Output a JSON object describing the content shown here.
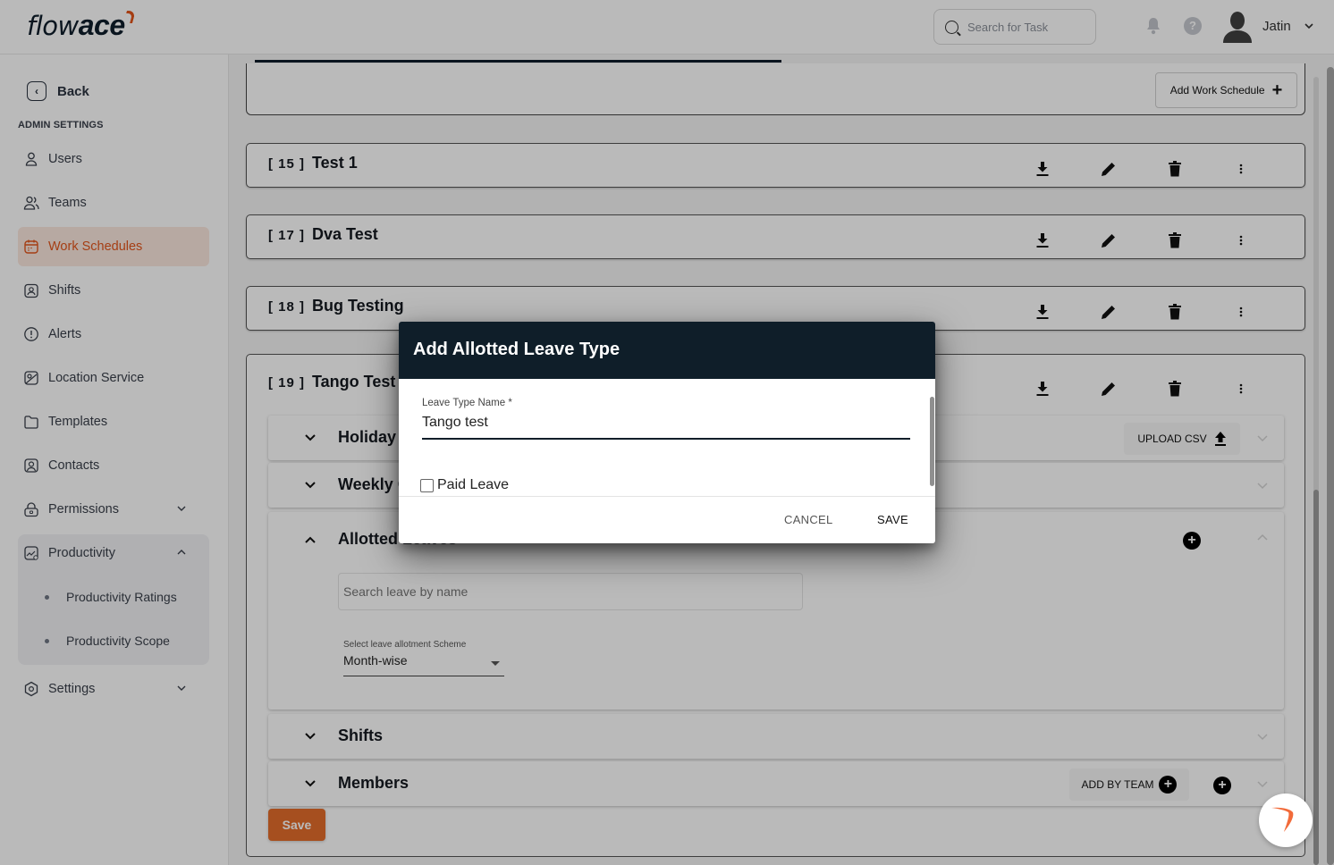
{
  "app": {
    "logo_light": "flow",
    "logo_bold": "ace"
  },
  "header": {
    "search_placeholder": "Search for Task",
    "user_name": "Jatin"
  },
  "sidebar": {
    "back_label": "Back",
    "section_label": "ADMIN SETTINGS",
    "items": [
      {
        "label": "Users",
        "icon": "user-icon"
      },
      {
        "label": "Teams",
        "icon": "team-icon"
      },
      {
        "label": "Work Schedules",
        "icon": "calendar-icon",
        "active": true
      },
      {
        "label": "Shifts",
        "icon": "shift-badge-icon"
      },
      {
        "label": "Alerts",
        "icon": "alert-icon"
      },
      {
        "label": "Location Service",
        "icon": "location-icon"
      },
      {
        "label": "Templates",
        "icon": "folder-icon"
      },
      {
        "label": "Contacts",
        "icon": "contact-icon"
      },
      {
        "label": "Permissions",
        "icon": "lock-icon",
        "expandable": true
      },
      {
        "label": "Productivity",
        "icon": "productivity-icon",
        "expanded": true
      },
      {
        "label": "Settings",
        "icon": "settings-icon",
        "expandable": true
      }
    ],
    "productivity_sub": [
      {
        "label": "Productivity Ratings"
      },
      {
        "label": "Productivity Scope"
      }
    ]
  },
  "main": {
    "add_work_schedule_label": "Add Work Schedule",
    "schedules": [
      {
        "id": "[ 15 ]",
        "name": "Test 1"
      },
      {
        "id": "[ 17 ]",
        "name": "Dva Test"
      },
      {
        "id": "[ 18 ]",
        "name": "Bug Testing"
      },
      {
        "id": "[ 19 ]",
        "name": "Tango Test"
      }
    ],
    "sections": {
      "holiday": "Holiday Schedule",
      "weekly": "Weekly Off",
      "allotted": "Allotted Leaves",
      "shifts": "Shifts",
      "members": "Members"
    },
    "upload_csv_label": "UPLOAD CSV",
    "search_leave_placeholder": "Search leave by name",
    "scheme_label": "Select leave allotment Scheme",
    "scheme_value": "Month-wise",
    "add_by_team_label": "ADD BY TEAM",
    "save_label": "Save"
  },
  "dialog": {
    "title": "Add Allotted Leave Type",
    "field_label": "Leave Type Name *",
    "field_value": "Tango test",
    "checkbox_label": "Paid Leave",
    "checkbox_checked": false,
    "cancel_label": "CANCEL",
    "save_label": "SAVE"
  },
  "colors": {
    "accent": "#e2561c",
    "dark": "#0f1e29",
    "save_button": "#e46d2b"
  }
}
